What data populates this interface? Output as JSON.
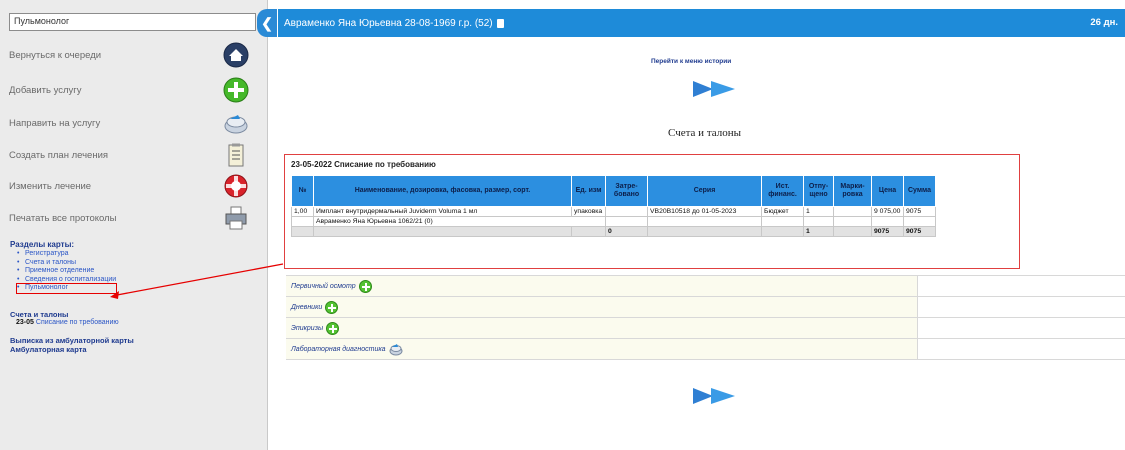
{
  "sidebar": {
    "role_value": "Пульмонолог",
    "actions": [
      {
        "label": "Вернуться к очереди"
      },
      {
        "label": "Добавить услугу"
      },
      {
        "label": "Направить на услугу"
      },
      {
        "label": "Создать план лечения"
      },
      {
        "label": "Изменить лечение"
      },
      {
        "label": "Печатать все протоколы"
      }
    ],
    "sections_title": "Разделы карты:",
    "sections": [
      "Регистратура",
      "Счета и талоны",
      "Приемное отделение",
      "Сведения о госпитализации",
      "Пульмонолог"
    ],
    "accounts_title": "Счета и талоны",
    "account_entry": {
      "date": "23-05",
      "label": "Списание по требованию"
    },
    "extract_link": "Выписка из амбулаторной карты",
    "card_link": "Амбулаторная карта"
  },
  "header": {
    "patient": "Авраменко Яна Юрьевна 28-08-1969 г.р. (52)",
    "date": "26 дн."
  },
  "main": {
    "history_link": "Перейти к меню истории",
    "section_heading": "Счета и талоны",
    "write_off": {
      "title": "23-05-2022 Списание по требованию",
      "columns": [
        "№",
        "Наименование, дозировка, фасовка, размер, сорт.",
        "Ед. изм",
        "Затре-бовано",
        "Серия",
        "Ист. финанс.",
        "Отпу-щено",
        "Марки-ровка",
        "Цена",
        "Сумма"
      ],
      "row": {
        "num": "1,00",
        "name": "Имплант внутридермальный Juviderm Voluma 1 мл",
        "unit": "упаковка",
        "requested": "",
        "series": "VB20B10518 до 01-05-2023",
        "finance": "Бюджет",
        "released": "1",
        "marking": "",
        "price": "9 075,00",
        "sum": "9075"
      },
      "patient_row": "Авраменко Яна Юрьевна 1062/21 (0)",
      "total": {
        "requested": "0",
        "released": "1",
        "price": "9075",
        "sum": "9075"
      }
    },
    "docs": [
      {
        "label": "Первичный осмотр"
      },
      {
        "label": "Дневники"
      },
      {
        "label": "Эпикризы"
      },
      {
        "label": "Лабораторная диагностика"
      }
    ]
  },
  "colors": {
    "header_bg": "#1e8bd9",
    "table_header_bg": "#2c8fe0",
    "annotation_red": "#e60000",
    "link_blue": "#1f3b8f"
  }
}
